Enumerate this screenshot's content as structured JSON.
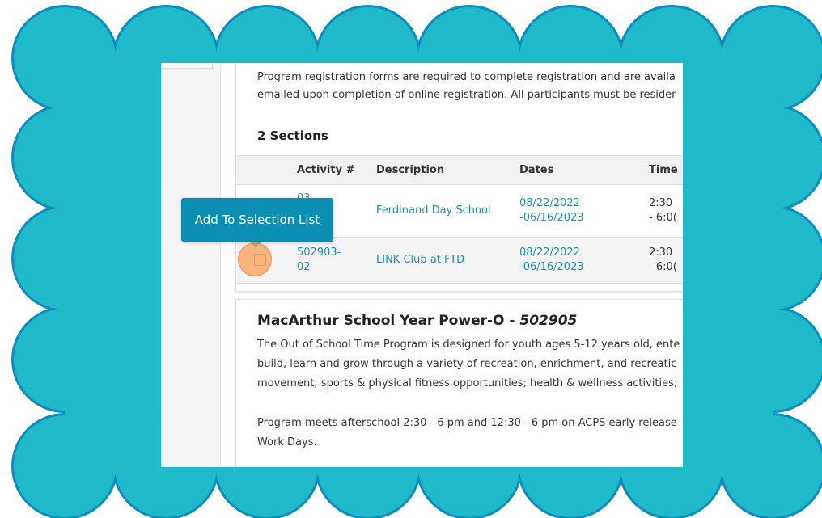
{
  "frame": {
    "scallop_color": "#1fb9c9",
    "scallop_outline": "#0c8cbf"
  },
  "program1": {
    "description_lines": [
      "Program registration forms are required to complete registration and are availa",
      "emailed upon completion of online registration. All participants must be resider"
    ],
    "sections_title": "2 Sections",
    "table": {
      "headers": [
        "Activity #",
        "Description",
        "Dates",
        "Time"
      ],
      "rows": [
        {
          "activity_top": "03-",
          "activity_bottom": "",
          "description": "Ferdinand Day School",
          "dates_top": "08/22/2022",
          "dates_bottom": "-06/16/2023",
          "time_top": "2:30",
          "time_bottom": "- 6:0("
        },
        {
          "activity_top": "502903-",
          "activity_bottom": "02",
          "description": "LINK Club at FTD",
          "dates_top": "08/22/2022",
          "dates_bottom": "-06/16/2023",
          "time_top": "2:30",
          "time_bottom": "- 6:0("
        }
      ]
    }
  },
  "program2": {
    "title": "MacArthur School Year Power-O - ",
    "number": "502905",
    "description_lines": [
      "The Out of School Time Program is designed for youth ages 5-12 years old, ente",
      "build, learn and grow through a variety of recreation, enrichment, and recreatic",
      "movement; sports & physical fitness opportunities; health & wellness activities;"
    ],
    "schedule_lines": [
      "Program meets afterschool 2:30 - 6 pm and 12:30 - 6 pm on ACPS early release",
      "Work Days."
    ]
  },
  "tooltip": {
    "label": "Add To Selection List"
  }
}
